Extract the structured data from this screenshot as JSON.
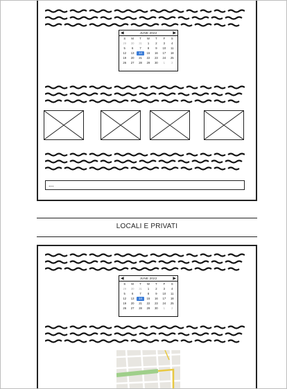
{
  "calendar": {
    "title": "JUNE 2022",
    "weekdays": [
      "S",
      "M",
      "T",
      "W",
      "T",
      "F",
      "S"
    ],
    "days": [
      "29",
      "30",
      "31",
      "1",
      "2",
      "3",
      "4",
      "5",
      "6",
      "7",
      "8",
      "9",
      "10",
      "11",
      "12",
      "13",
      "14",
      "15",
      "16",
      "17",
      "18",
      "19",
      "20",
      "21",
      "22",
      "23",
      "24",
      "25",
      "26",
      "27",
      "28",
      "29",
      "30",
      "1",
      "2"
    ],
    "selected_day": "14"
  },
  "text_field": {
    "value": "..."
  },
  "section": {
    "title": "LOCALI E PRIVATI"
  },
  "colors": {
    "accent": "#3b7dd8",
    "map_road": "#e8c840",
    "map_park": "#9fcf8a"
  }
}
